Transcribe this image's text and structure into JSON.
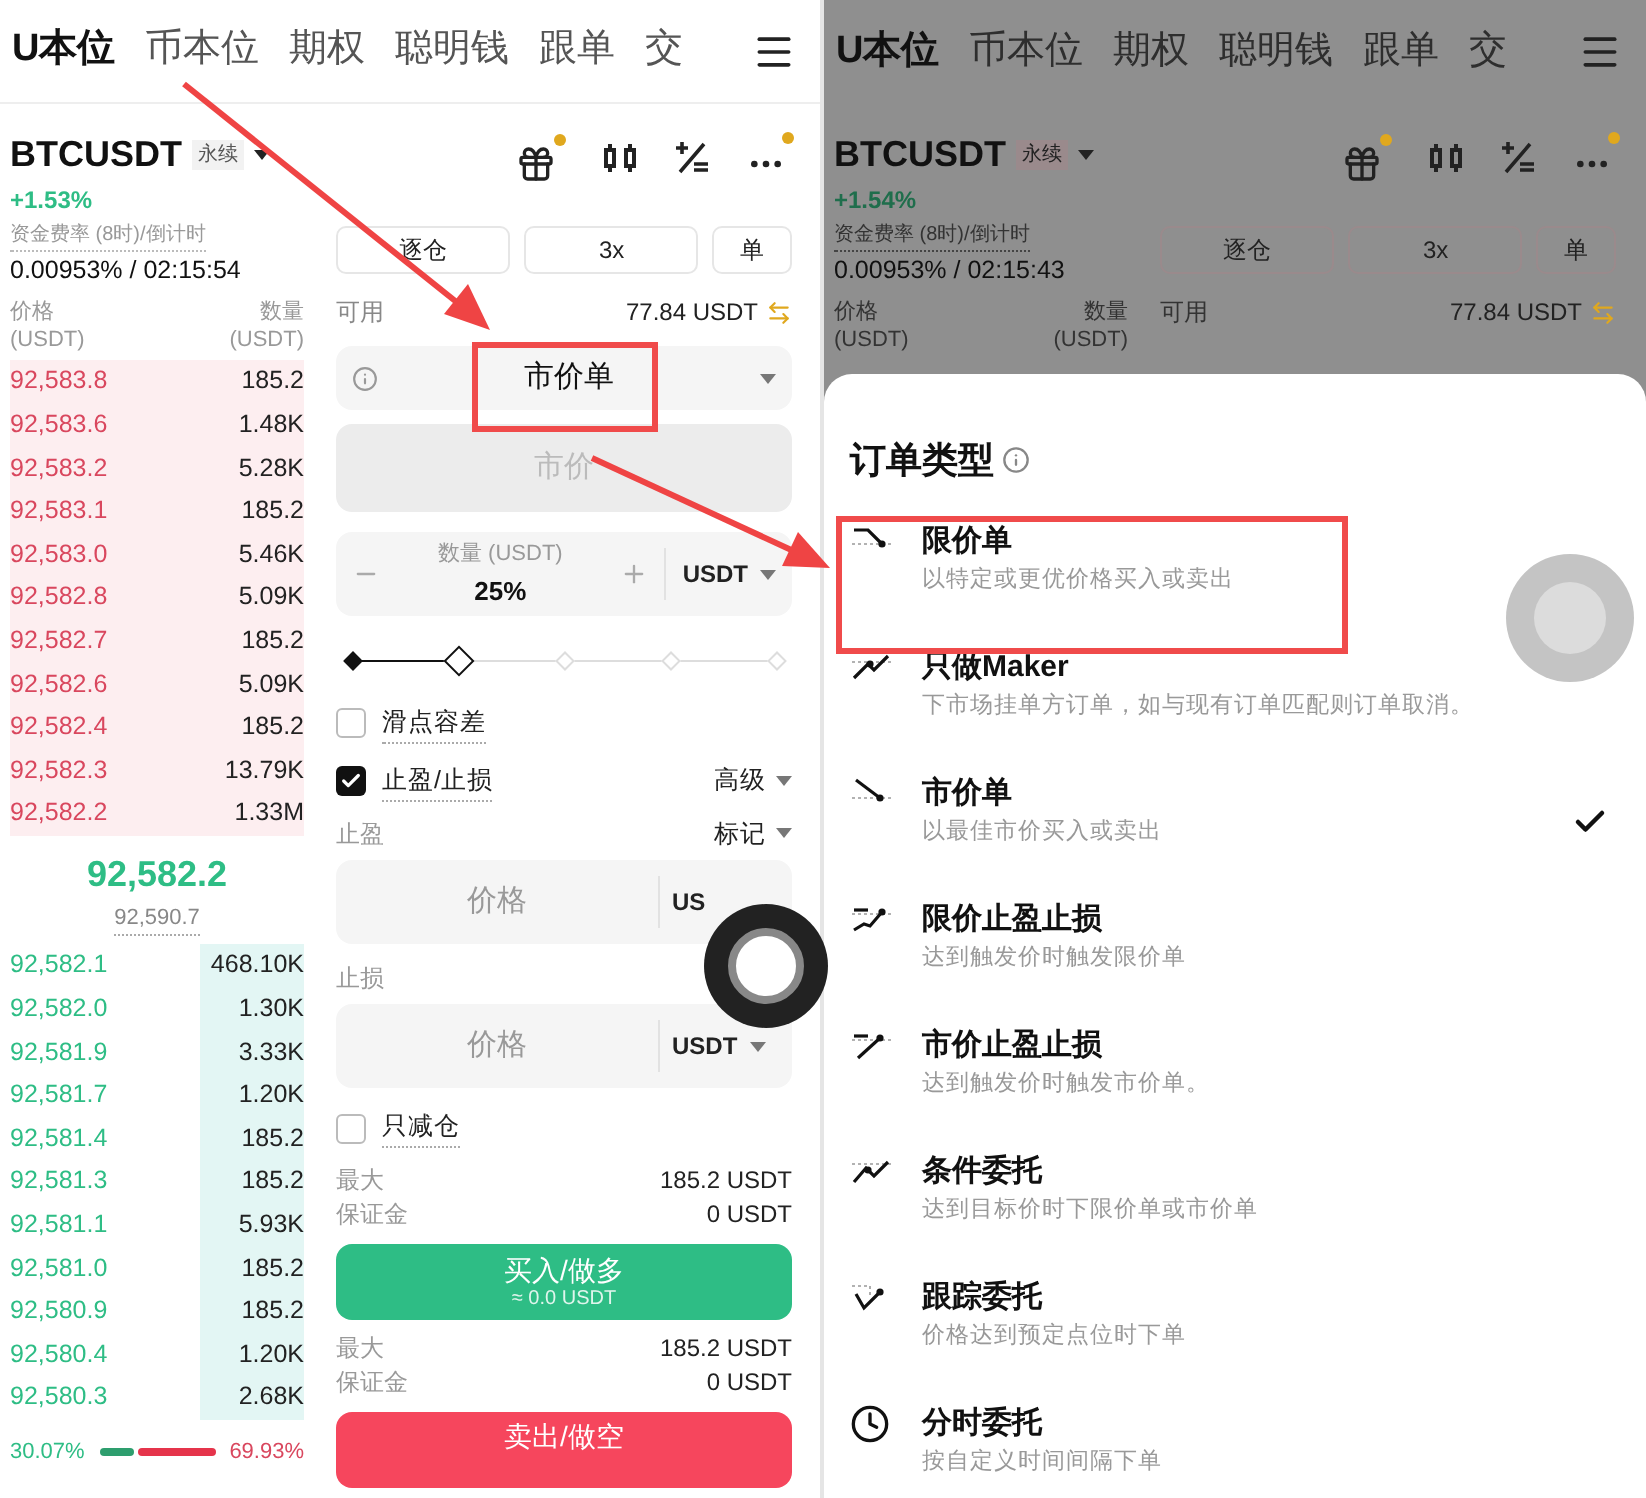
{
  "tabs": [
    {
      "label": "U本位",
      "selected": true
    },
    {
      "label": "币本位",
      "selected": false
    },
    {
      "label": "期权",
      "selected": false
    },
    {
      "label": "聪明钱",
      "selected": false
    },
    {
      "label": "跟单",
      "selected": false
    },
    {
      "label": "交",
      "selected": false
    }
  ],
  "symbol": {
    "name": "BTCUSDT",
    "badge": "永续",
    "change": "+1.53%"
  },
  "funding": {
    "label": "资金费率 (8时)/倒计时",
    "value": "0.00953% / 02:15:54"
  },
  "order_book": {
    "price_header": "价格",
    "price_unit": "(USDT)",
    "qty_header": "数量",
    "qty_unit": "(USDT)",
    "asks": [
      {
        "price": "92,583.8",
        "qty": "185.2"
      },
      {
        "price": "92,583.6",
        "qty": "1.48K"
      },
      {
        "price": "92,583.2",
        "qty": "5.28K"
      },
      {
        "price": "92,583.1",
        "qty": "185.2"
      },
      {
        "price": "92,583.0",
        "qty": "5.46K"
      },
      {
        "price": "92,582.8",
        "qty": "5.09K"
      },
      {
        "price": "92,582.7",
        "qty": "185.2"
      },
      {
        "price": "92,582.6",
        "qty": "5.09K"
      },
      {
        "price": "92,582.4",
        "qty": "185.2"
      },
      {
        "price": "92,582.3",
        "qty": "13.79K"
      },
      {
        "price": "92,582.2",
        "qty": "1.33M"
      }
    ],
    "last_price": "92,582.2",
    "mark_price": "92,590.7",
    "bids": [
      {
        "price": "92,582.1",
        "qty": "468.10K"
      },
      {
        "price": "92,582.0",
        "qty": "1.30K"
      },
      {
        "price": "92,581.9",
        "qty": "3.33K"
      },
      {
        "price": "92,581.7",
        "qty": "1.20K"
      },
      {
        "price": "92,581.4",
        "qty": "185.2"
      },
      {
        "price": "92,581.3",
        "qty": "185.2"
      },
      {
        "price": "92,581.1",
        "qty": "5.93K"
      },
      {
        "price": "92,581.0",
        "qty": "185.2"
      },
      {
        "price": "92,580.9",
        "qty": "185.2"
      },
      {
        "price": "92,580.4",
        "qty": "1.20K"
      },
      {
        "price": "92,580.3",
        "qty": "2.68K"
      }
    ],
    "buy_ratio": "30.07%",
    "sell_ratio": "69.93%",
    "level": 0.3007
  },
  "order_form": {
    "margin_mode": "逐仓",
    "leverage": "3x",
    "position_mode": "单",
    "available_label": "可用",
    "available": "77.84 USDT",
    "order_type": "市价单",
    "price_text": "市价",
    "quantity_label": "数量 (USDT)",
    "quantity": "25%",
    "quantity_unit": "USDT",
    "level": 0.25,
    "slippage": {
      "label": "滑点容差",
      "checked": false
    },
    "tpsl": {
      "label": "止盈/止损",
      "checked": true,
      "mode": "高级"
    },
    "take_profit": {
      "label": "止盈",
      "trigger": "标记",
      "placeholder": "价格",
      "unit": "US"
    },
    "stop_loss": {
      "label": "止损",
      "placeholder": "价格",
      "unit": "USDT"
    },
    "reduce_only": {
      "label": "只减仓",
      "checked": false
    },
    "buy": {
      "max_label": "最大",
      "max": "185.2 USDT",
      "margin_label": "保证金",
      "margin": "0 USDT",
      "button": "买入/做多",
      "sub": "≈ 0.0 USDT"
    },
    "sell": {
      "max_label": "最大",
      "max": "185.2 USDT",
      "margin_label": "保证金",
      "margin": "0 USDT",
      "button": "卖出/做空"
    }
  },
  "background_screen": {
    "tabs": [
      {
        "label": "U本位",
        "selected": true
      },
      {
        "label": "币本位",
        "selected": false
      },
      {
        "label": "期权",
        "selected": false
      },
      {
        "label": "聪明钱",
        "selected": false
      },
      {
        "label": "跟单",
        "selected": false
      },
      {
        "label": "交",
        "selected": false
      }
    ],
    "symbol": {
      "name": "BTCUSDT",
      "badge": "永续",
      "change": "+1.54%"
    },
    "funding": {
      "label": "资金费率 (8时)/倒计时",
      "value": "0.00953% / 02:15:43"
    },
    "order_book": {
      "price_header": "价格",
      "price_unit": "(USDT)",
      "qty_header": "数量",
      "qty_unit": "(USDT)"
    },
    "order_form": {
      "margin_mode": "逐仓",
      "leverage": "3x",
      "position_mode": "单",
      "available_label": "可用",
      "available": "77.84 USDT"
    }
  },
  "order_type_sheet": {
    "title": "订单类型",
    "items": [
      {
        "kind": "limit",
        "title": "限价单",
        "description": "以特定或更优价格买入或卖出",
        "selected": false
      },
      {
        "kind": "post_only",
        "title": "只做Maker",
        "description": "下市场挂单方订单，如与现有订单匹配则订单取消。",
        "selected": false
      },
      {
        "kind": "market",
        "title": "市价单",
        "description": "以最佳市价买入或卖出",
        "selected": true
      },
      {
        "kind": "limit_tpsl",
        "title": "限价止盈止损",
        "description": "达到触发价时触发限价单",
        "selected": false
      },
      {
        "kind": "market_tpsl",
        "title": "市价止盈止损",
        "description": "达到触发价时触发市价单。",
        "selected": false
      },
      {
        "kind": "conditional",
        "title": "条件委托",
        "description": "达到目标价时下限价单或市价单",
        "selected": false
      },
      {
        "kind": "trailing",
        "title": "跟踪委托",
        "description": "价格达到预定点位时下单",
        "selected": false
      },
      {
        "kind": "twap",
        "title": "分时委托",
        "description": "按自定义时间间隔下单",
        "selected": false
      }
    ]
  }
}
